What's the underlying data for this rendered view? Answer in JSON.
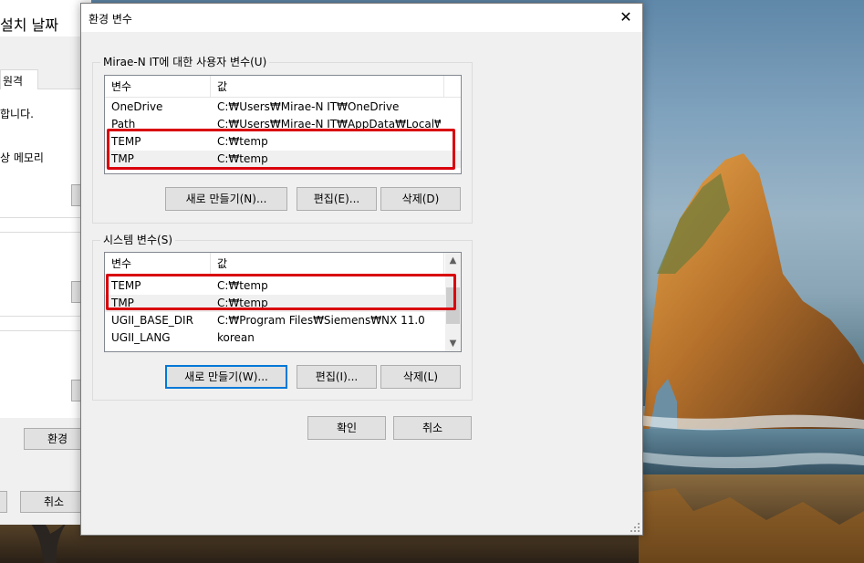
{
  "background_window": {
    "title": "설치 날짜",
    "tab_label": "원격",
    "text_1": "합니다.",
    "text_2": "상 메모리",
    "env_button": "환경",
    "cancel_button": "취소"
  },
  "dialog": {
    "title": "환경 변수",
    "close_glyph": "✕",
    "user_group": {
      "label": "Mirae-N IT에 대한 사용자 변수(U)",
      "columns": [
        "변수",
        "값"
      ],
      "rows": [
        {
          "name": "OneDrive",
          "value": "C:₩Users₩Mirae-N IT₩OneDrive"
        },
        {
          "name": "Path",
          "value": "C:₩Users₩Mirae-N IT₩AppData₩Local₩Mi..."
        },
        {
          "name": "TEMP",
          "value": "C:₩temp"
        },
        {
          "name": "TMP",
          "value": "C:₩temp"
        }
      ],
      "new_button": "새로 만들기(N)...",
      "edit_button": "편집(E)...",
      "delete_button": "삭제(D)"
    },
    "system_group": {
      "label": "시스템 변수(S)",
      "columns": [
        "변수",
        "값"
      ],
      "rows": [
        {
          "name": "TEMP",
          "value": "C:₩temp"
        },
        {
          "name": "TMP",
          "value": "C:₩temp"
        },
        {
          "name": "UGII_BASE_DIR",
          "value": "C:₩Program Files₩Siemens₩NX 11.0"
        },
        {
          "name": "UGII_LANG",
          "value": "korean"
        }
      ],
      "new_button": "새로 만들기(W)...",
      "edit_button": "편집(I)...",
      "delete_button": "삭제(L)"
    },
    "ok_button": "확인",
    "cancel_button": "취소"
  },
  "colors": {
    "highlight": "#d9000d",
    "focus": "#0078d7"
  }
}
